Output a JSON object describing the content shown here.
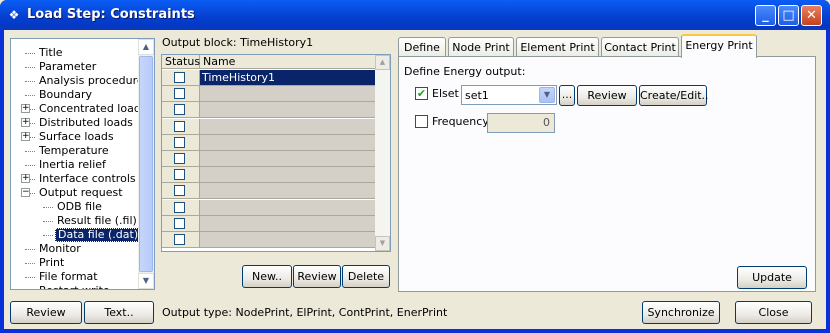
{
  "window": {
    "title": "Load Step: Constraints",
    "minimize_glyph": "_",
    "maximize_glyph": "□",
    "close_glyph": "✕"
  },
  "tree": {
    "items": [
      {
        "label": "Title",
        "level": 0,
        "expander": "none",
        "selected": false
      },
      {
        "label": "Parameter",
        "level": 0,
        "expander": "none",
        "selected": false
      },
      {
        "label": "Analysis procedure",
        "level": 0,
        "expander": "none",
        "selected": false
      },
      {
        "label": "Boundary",
        "level": 0,
        "expander": "none",
        "selected": false
      },
      {
        "label": "Concentrated loads",
        "level": 0,
        "expander": "plus",
        "selected": false
      },
      {
        "label": "Distributed loads",
        "level": 0,
        "expander": "plus",
        "selected": false
      },
      {
        "label": "Surface loads",
        "level": 0,
        "expander": "plus",
        "selected": false
      },
      {
        "label": "Temperature",
        "level": 0,
        "expander": "none",
        "selected": false
      },
      {
        "label": "Inertia relief",
        "level": 0,
        "expander": "none",
        "selected": false
      },
      {
        "label": "Interface controls",
        "level": 0,
        "expander": "plus",
        "selected": false
      },
      {
        "label": "Output request",
        "level": 0,
        "expander": "minus",
        "selected": false
      },
      {
        "label": "ODB file",
        "level": 1,
        "expander": "none",
        "selected": false
      },
      {
        "label": "Result file (.fil)",
        "level": 1,
        "expander": "none",
        "selected": false
      },
      {
        "label": "Data file (.dat)",
        "level": 1,
        "expander": "none",
        "selected": true
      },
      {
        "label": "Monitor",
        "level": 0,
        "expander": "none",
        "selected": false
      },
      {
        "label": "Print",
        "level": 0,
        "expander": "none",
        "selected": false
      },
      {
        "label": "File format",
        "level": 0,
        "expander": "none",
        "selected": false
      },
      {
        "label": "Restart write",
        "level": 0,
        "expander": "none",
        "selected": false
      }
    ]
  },
  "left_buttons": {
    "review": "Review",
    "text": "Text.."
  },
  "output_block": {
    "label": "Output block: TimeHistory1",
    "columns": [
      "Status",
      "Name"
    ],
    "rows": [
      {
        "checked": false,
        "name": "TimeHistory1",
        "selected": true
      },
      {
        "checked": false,
        "name": "",
        "selected": false
      },
      {
        "checked": false,
        "name": "",
        "selected": false
      },
      {
        "checked": false,
        "name": "",
        "selected": false
      },
      {
        "checked": false,
        "name": "",
        "selected": false
      },
      {
        "checked": false,
        "name": "",
        "selected": false
      },
      {
        "checked": false,
        "name": "",
        "selected": false
      },
      {
        "checked": false,
        "name": "",
        "selected": false
      },
      {
        "checked": false,
        "name": "",
        "selected": false
      },
      {
        "checked": false,
        "name": "",
        "selected": false
      },
      {
        "checked": false,
        "name": "",
        "selected": false
      }
    ],
    "buttons": {
      "new": "New..",
      "review": "Review",
      "delete": "Delete"
    }
  },
  "tabs": [
    {
      "label": "Define",
      "active": false
    },
    {
      "label": "Node Print",
      "active": false
    },
    {
      "label": "Element Print",
      "active": false
    },
    {
      "label": "Contact Print",
      "active": false
    },
    {
      "label": "Energy Print",
      "active": true
    }
  ],
  "energy": {
    "heading": "Define Energy output:",
    "elset_label": "Elset",
    "elset_checked": true,
    "elset_value": "set1",
    "browse": "...",
    "review": "Review",
    "create_edit": "Create/Edit..",
    "frequency_label": "Frequency",
    "frequency_checked": false,
    "frequency_value": "0",
    "update": "Update"
  },
  "footer": {
    "output_type": "Output type:  NodePrint, ElPrint, ContPrint, EnerPrint",
    "synchronize": "Synchronize",
    "close": "Close"
  },
  "icons": {
    "window_icon": "load-step-icon",
    "check_mark": "✔",
    "arrow_up": "▲",
    "arrow_down": "▼"
  }
}
